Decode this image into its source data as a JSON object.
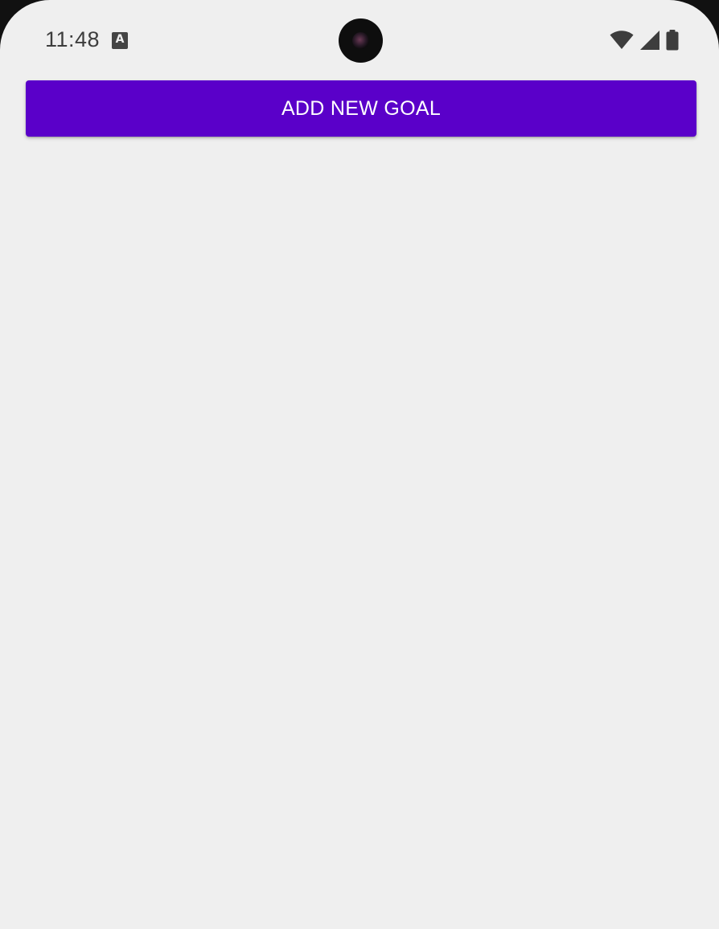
{
  "status_bar": {
    "time": "11:48",
    "notification_icon_letter": "A",
    "icons": [
      "wifi-icon",
      "cellular-signal-icon",
      "battery-icon"
    ]
  },
  "main": {
    "add_goal_label": "ADD NEW GOAL",
    "goals": []
  },
  "colors": {
    "accent": "#5a00c9",
    "background": "#efefef",
    "status_text": "#3d3d3d"
  }
}
